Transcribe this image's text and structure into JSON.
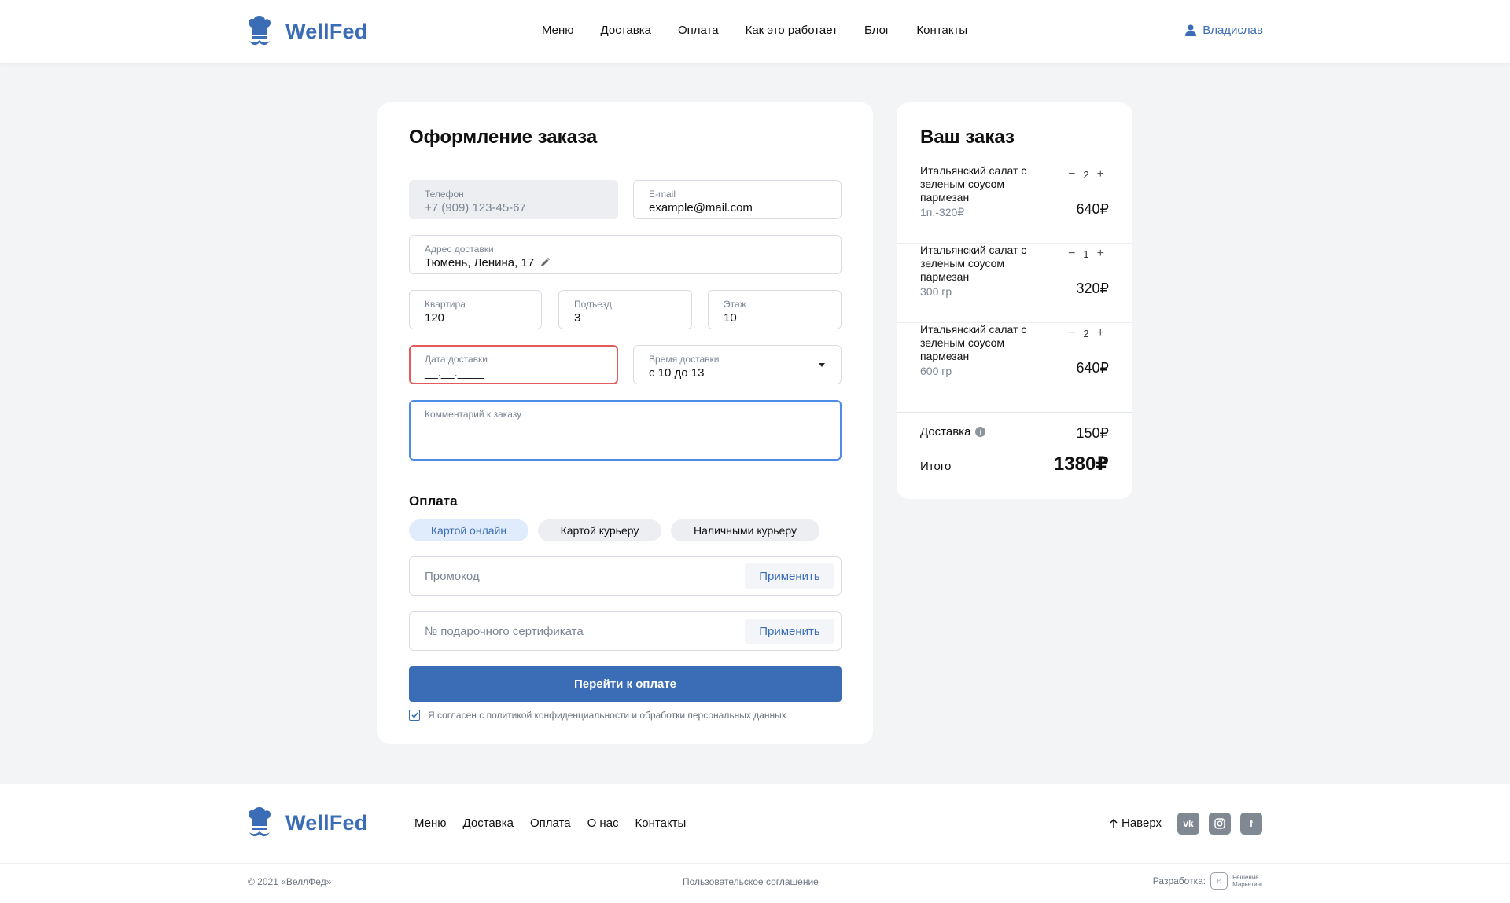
{
  "brand": {
    "name": "WellFed",
    "color": "#3b6db6"
  },
  "header": {
    "nav": [
      "Меню",
      "Доставка",
      "Оплата",
      "Как это работает",
      "Блог",
      "Контакты"
    ],
    "user": "Владислав"
  },
  "checkout": {
    "title": "Оформление заказа",
    "phone": {
      "label": "Телефон",
      "value": "+7 (909) 123-45-67"
    },
    "email": {
      "label": "E-mail",
      "value": "example@mail.com"
    },
    "address": {
      "label": "Адрес доставки",
      "value": "Тюмень, Ленина, 17"
    },
    "apartment": {
      "label": "Квартира",
      "value": "120"
    },
    "entrance": {
      "label": "Подъезд",
      "value": "3"
    },
    "floor": {
      "label": "Этаж",
      "value": "10"
    },
    "date": {
      "label": "Дата доставки",
      "value": "__.__.____"
    },
    "time": {
      "label": "Время доставки",
      "value": "с 10 до 13"
    },
    "comment": {
      "label": "Комментарий к заказу",
      "value": ""
    },
    "payment": {
      "title": "Оплата",
      "options": [
        "Картой онлайн",
        "Картой курьеру",
        "Наличными курьеру"
      ],
      "selected": "Картой онлайн"
    },
    "promo": {
      "placeholder": "Промокод",
      "apply": "Применить"
    },
    "gift": {
      "placeholder": "№ подарочного сертификата",
      "apply": "Применить"
    },
    "submit": "Перейти к оплате",
    "agree": "Я согласен с политикой конфиденциальности и обработки персональных данных",
    "agree_checked": true
  },
  "order": {
    "title": "Ваш заказ",
    "items": [
      {
        "name": "Итальянский салат с зеленым соусом пармезан",
        "qty": "2",
        "sub": "1п.-320₽",
        "price": "640₽"
      },
      {
        "name": "Итальянский салат с зеленым соусом пармезан",
        "qty": "1",
        "sub": "300 гр",
        "price": "320₽"
      },
      {
        "name": "Итальянский салат с зеленым соусом пармезан",
        "qty": "2",
        "sub": "600 гр",
        "price": "640₽"
      }
    ],
    "delivery_label": "Доставка",
    "delivery_price": "150₽",
    "total_label": "Итого",
    "total": "1380₽"
  },
  "footer": {
    "nav": [
      "Меню",
      "Доставка",
      "Оплата",
      "О нас",
      "Контакты"
    ],
    "up": "Наверх",
    "social": [
      "vk",
      "instagram",
      "facebook"
    ],
    "copyright": "© 2021 «ВеллФед»",
    "terms": "Пользовательское соглашение",
    "dev_label": "Разработка:",
    "dev_company_1": "Решение",
    "dev_company_2": "Маркетинг"
  }
}
